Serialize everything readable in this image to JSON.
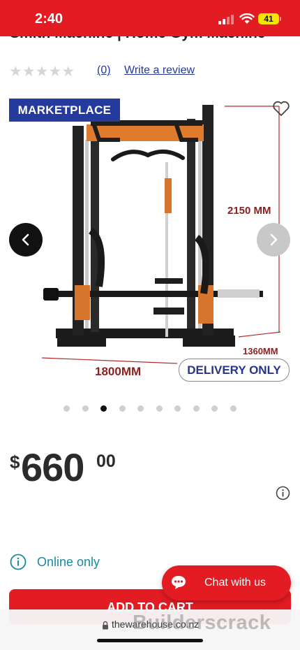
{
  "status_bar": {
    "time": "2:40",
    "battery": "41"
  },
  "product": {
    "title": "Smith Machine | Home Gym Machine",
    "rating_count": "(0)",
    "write_review": "Write a review",
    "badge": "MARKETPLACE",
    "dimensions": {
      "height": "2150 MM",
      "depth": "1360MM",
      "width": "1800MM"
    },
    "delivery_badge": "DELIVERY ONLY",
    "rating_stars": 0,
    "carousel": {
      "total": 10,
      "active_index": 2
    },
    "price": {
      "currency": "$",
      "whole": "660",
      "cents": "00"
    },
    "availability": "Online only"
  },
  "chat": {
    "label": "Chat with us"
  },
  "cta": {
    "add_to_cart": "ADD TO CART"
  },
  "browser": {
    "url": "thewarehouse.co.nz"
  },
  "watermark": "Builderscrack",
  "colors": {
    "brand_red": "#e31b23",
    "navy": "#243a9c",
    "orange": "#e07a2c",
    "teal": "#1a8aa0"
  }
}
